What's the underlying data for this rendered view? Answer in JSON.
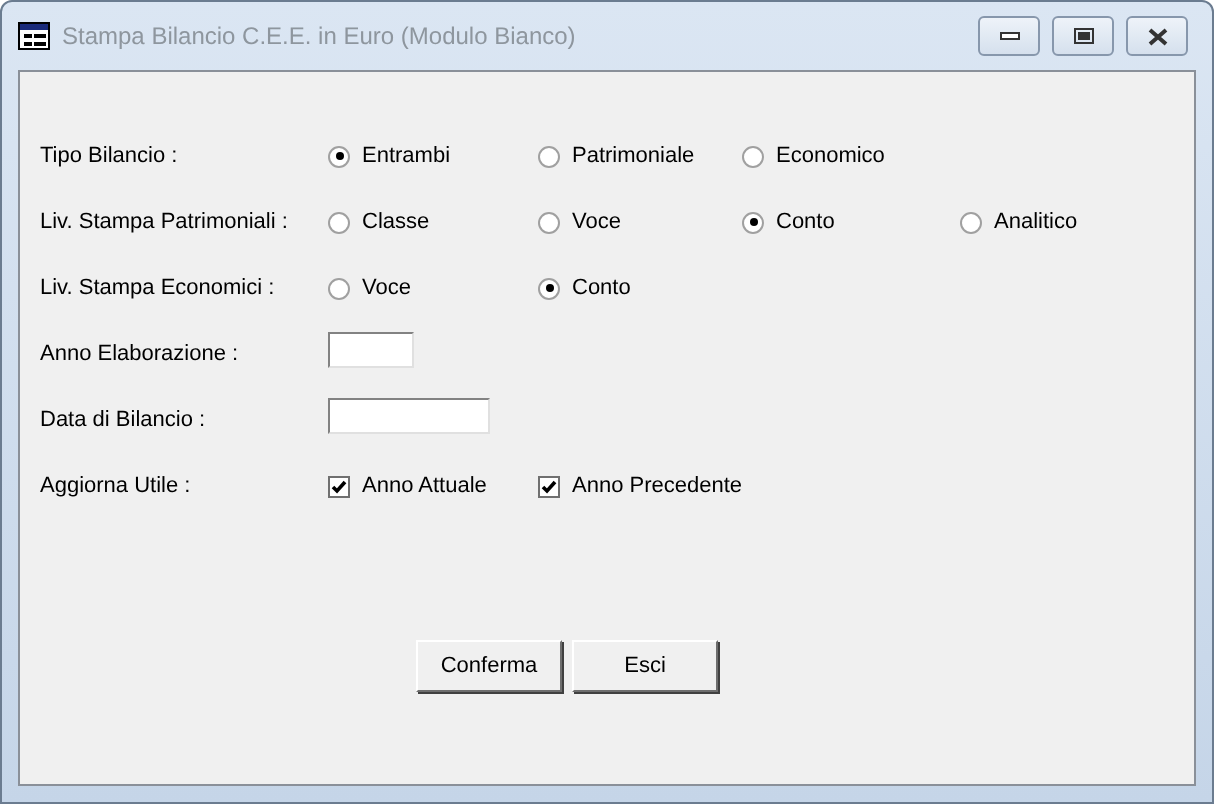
{
  "window": {
    "title": "Stampa Bilancio C.E.E. in Euro (Modulo Bianco)"
  },
  "rows": [
    {
      "kind": "radio",
      "label": "Tipo Bilancio :",
      "options": [
        {
          "label": "Entrambi",
          "selected": true
        },
        {
          "label": "Patrimoniale",
          "selected": false
        },
        {
          "label": "Economico",
          "selected": false
        }
      ]
    },
    {
      "kind": "radio",
      "label": "Liv. Stampa Patrimoniali :",
      "options": [
        {
          "label": "Classe",
          "selected": false
        },
        {
          "label": "Voce",
          "selected": false
        },
        {
          "label": "Conto",
          "selected": true
        },
        {
          "label": "Analitico",
          "selected": false
        }
      ]
    },
    {
      "kind": "radio",
      "label": "Liv. Stampa Economici :",
      "options": [
        {
          "label": "Voce",
          "selected": false
        },
        {
          "label": "Conto",
          "selected": true
        }
      ]
    },
    {
      "kind": "year",
      "label": "Anno Elaborazione :"
    },
    {
      "kind": "date",
      "label": "Data di Bilancio :"
    },
    {
      "kind": "check",
      "label": "Aggiorna Utile :",
      "options": [
        {
          "label": "Anno Attuale",
          "checked": true
        },
        {
          "label": "Anno Precedente",
          "checked": true
        }
      ]
    }
  ],
  "buttons": [
    "Conferma",
    "Esci"
  ]
}
